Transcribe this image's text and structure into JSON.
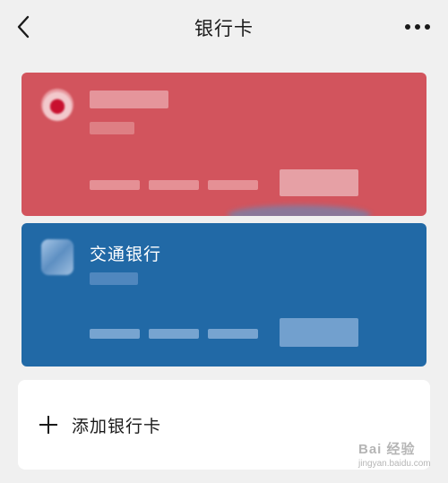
{
  "header": {
    "title": "银行卡",
    "back_icon": "chevron-left-icon",
    "more_icon": "more-dots-icon"
  },
  "cards": [
    {
      "id": "card-1",
      "bank_name": "",
      "color": "#d2545d",
      "blurred": true
    },
    {
      "id": "card-2",
      "bank_name": "交通银行",
      "color": "#2169a6",
      "blurred": true
    }
  ],
  "add_card": {
    "icon": "plus-icon",
    "label": "添加银行卡"
  },
  "watermark": {
    "text": "Bai 经验",
    "url": "jingyan.baidu.com"
  }
}
